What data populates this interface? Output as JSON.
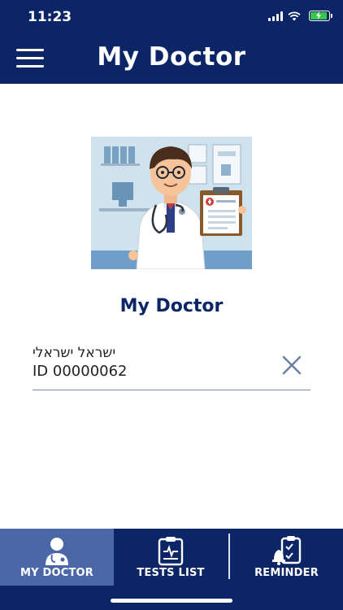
{
  "status_bar": {
    "time": "11:23"
  },
  "header": {
    "title": "My Doctor"
  },
  "main": {
    "title": "My Doctor",
    "doctor": {
      "name": "ישראל ישראלי",
      "id_text": "ID 00000062"
    }
  },
  "tabbar": {
    "tabs": [
      {
        "label": "MY DOCTOR",
        "icon": "doctor-icon",
        "active": true
      },
      {
        "label": "TESTS LIST",
        "icon": "clipboard-icon",
        "active": false
      },
      {
        "label": "REMINDER",
        "icon": "reminder-icon",
        "active": false
      }
    ]
  },
  "colors": {
    "primary": "#0b2566",
    "active_tab": "#4a67a8",
    "battery": "#3ac64b"
  }
}
